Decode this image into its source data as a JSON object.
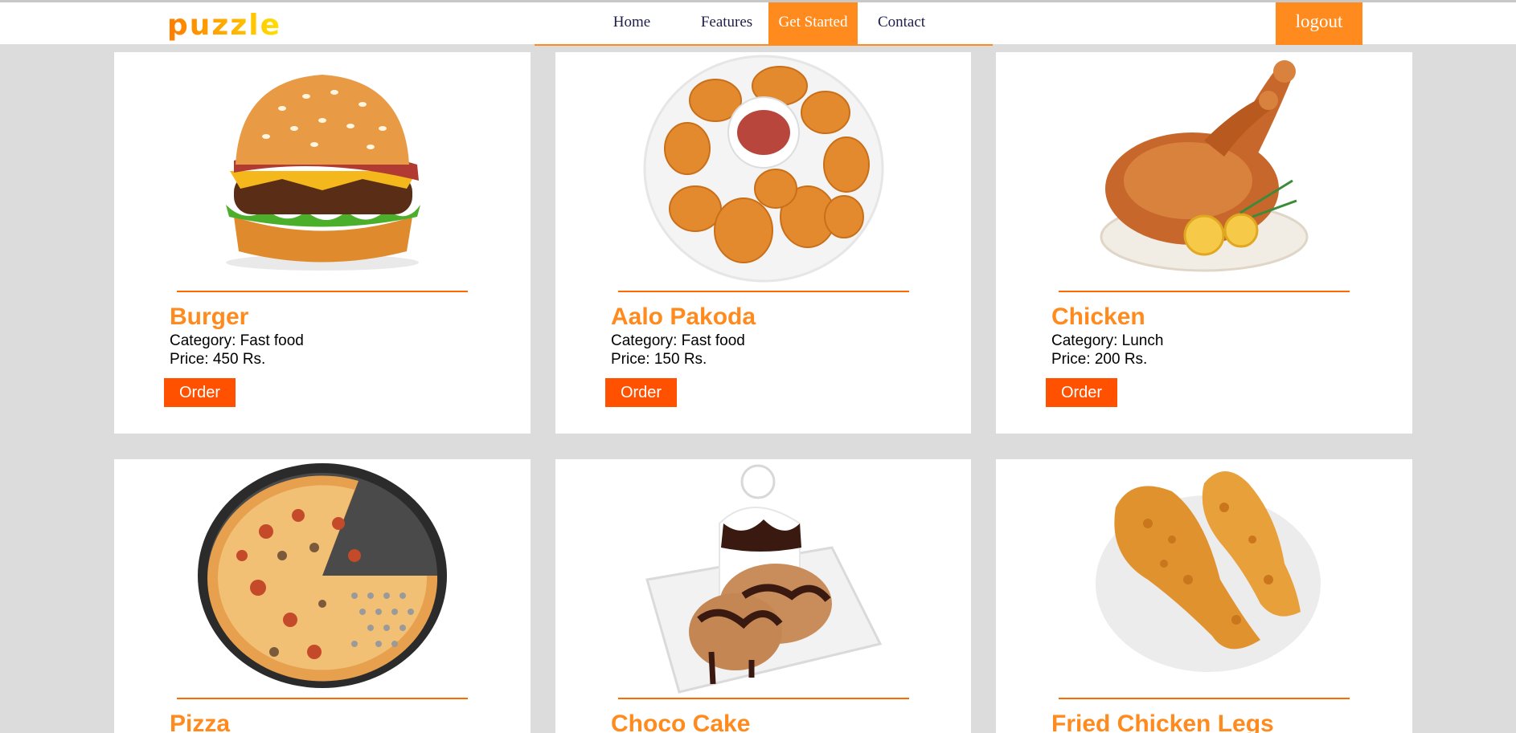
{
  "header": {
    "logo": "puzzle",
    "nav": [
      {
        "label": "Home",
        "active": false
      },
      {
        "label": "Features",
        "active": false
      },
      {
        "label": "Get Started",
        "active": true
      },
      {
        "label": "Contact",
        "active": false
      }
    ],
    "logout_label": "logout"
  },
  "colors": {
    "accent": "#ff8a1e",
    "order_button": "#ff5100",
    "background": "#dcdcdc"
  },
  "products": [
    {
      "name": "Burger",
      "category": "Category: Fast food",
      "price": "Price: 450 Rs.",
      "order_label": "Order",
      "image": "burger-image"
    },
    {
      "name": "Aalo Pakoda",
      "category": "Category: Fast food",
      "price": "Price: 150 Rs.",
      "order_label": "Order",
      "image": "nuggets-image"
    },
    {
      "name": "Chicken",
      "category": "Category: Lunch",
      "price": "Price: 200 Rs.",
      "order_label": "Order",
      "image": "roast-chicken-image"
    },
    {
      "name": "Pizza",
      "image": "pizza-image"
    },
    {
      "name": "Choco Cake",
      "image": "choco-cake-image"
    },
    {
      "name": "Fried Chicken Legs",
      "image": "fried-chicken-image"
    }
  ]
}
